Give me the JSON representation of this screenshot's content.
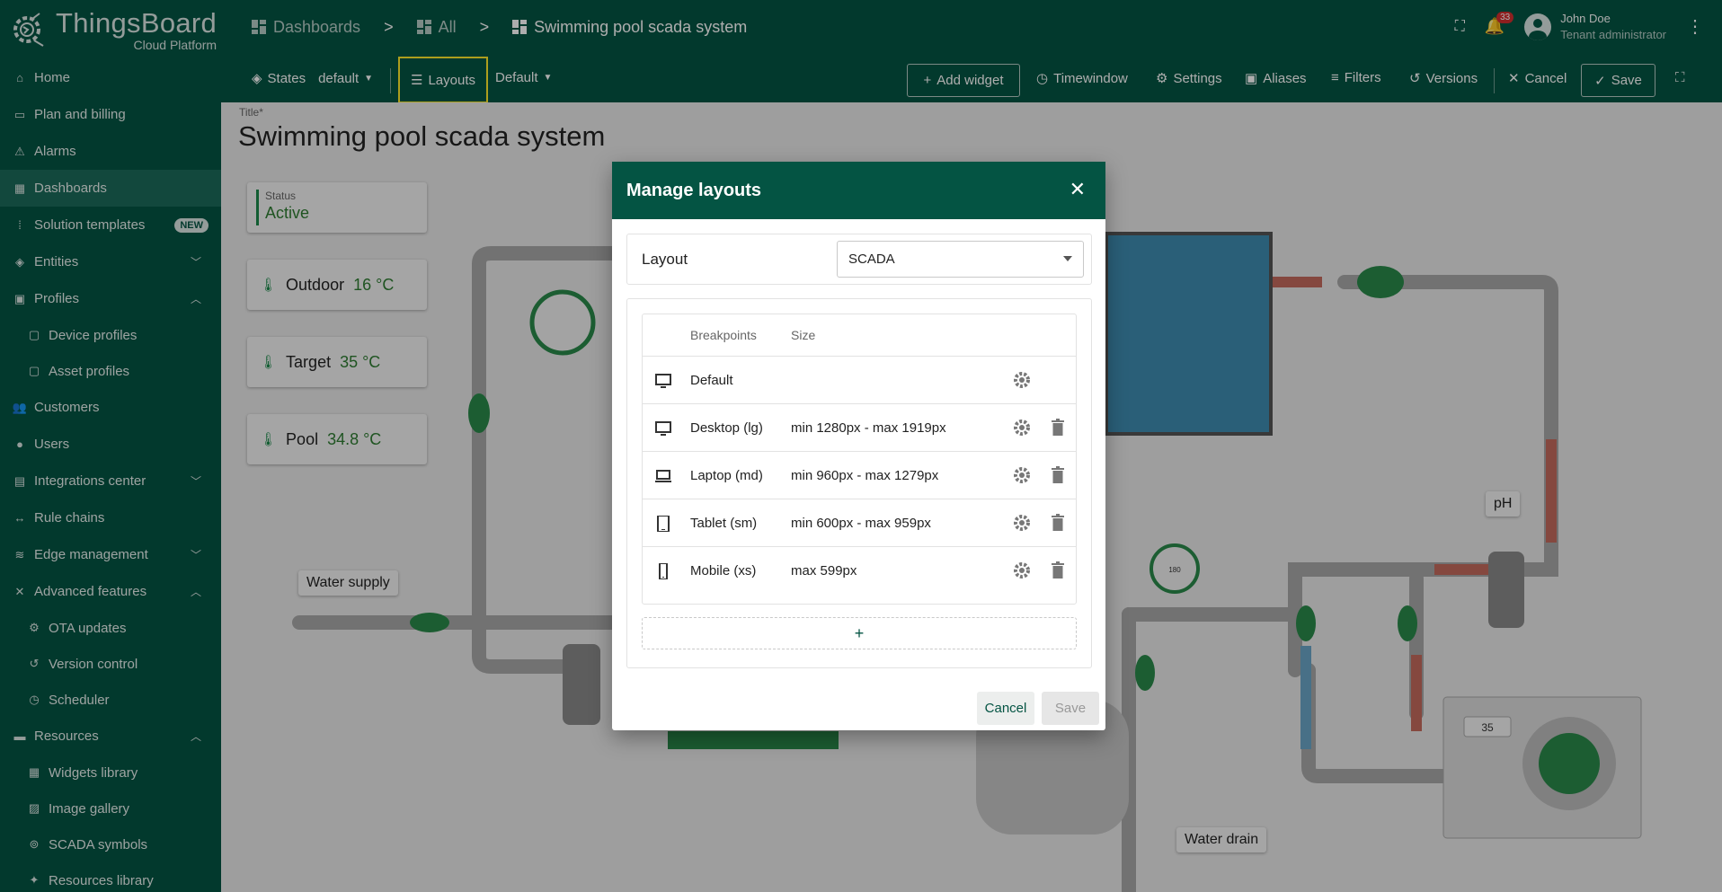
{
  "app": {
    "brand": "ThingsBoard",
    "platform": "Cloud Platform"
  },
  "sidebar": {
    "items": [
      {
        "label": "Home"
      },
      {
        "label": "Plan and billing"
      },
      {
        "label": "Alarms"
      },
      {
        "label": "Dashboards"
      },
      {
        "label": "Solution templates",
        "badge": "NEW"
      },
      {
        "label": "Entities"
      },
      {
        "label": "Profiles"
      },
      {
        "label": "Device profiles"
      },
      {
        "label": "Asset profiles"
      },
      {
        "label": "Customers"
      },
      {
        "label": "Users"
      },
      {
        "label": "Integrations center"
      },
      {
        "label": "Rule chains"
      },
      {
        "label": "Edge management"
      },
      {
        "label": "Advanced features"
      },
      {
        "label": "OTA updates"
      },
      {
        "label": "Version control"
      },
      {
        "label": "Scheduler"
      },
      {
        "label": "Resources"
      },
      {
        "label": "Widgets library"
      },
      {
        "label": "Image gallery"
      },
      {
        "label": "SCADA symbols"
      },
      {
        "label": "Resources library"
      }
    ]
  },
  "header": {
    "crumbs": [
      "Dashboards",
      "All",
      "Swimming pool scada system"
    ],
    "crumb_sep": ">",
    "notifications": "33",
    "user_name": "John Doe",
    "user_role": "Tenant administrator"
  },
  "toolbar": {
    "states_label": "States",
    "state_value": "default",
    "layouts_label": "Layouts",
    "layout_value": "Default",
    "add_widget": "Add widget",
    "timewindow": "Timewindow",
    "settings": "Settings",
    "aliases": "Aliases",
    "filters": "Filters",
    "versions": "Versions",
    "cancel": "Cancel",
    "save": "Save"
  },
  "dashboard": {
    "title_label": "Title*",
    "title": "Swimming pool scada system",
    "status": {
      "label": "Status",
      "value": "Active"
    },
    "temps": [
      {
        "label": "Outdoor",
        "value": "16 °C"
      },
      {
        "label": "Target",
        "value": "35 °C"
      },
      {
        "label": "Pool",
        "value": "34.8 °C"
      }
    ],
    "tags": {
      "water_supply": "Water supply",
      "ph": "pH",
      "water_drain": "Water drain",
      "heater_value": "35",
      "flow_value": "180"
    }
  },
  "dialog": {
    "title": "Manage layouts",
    "layout_label": "Layout",
    "layout_value": "SCADA",
    "col_breakpoints": "Breakpoints",
    "col_size": "Size",
    "breakpoints": [
      {
        "name": "Default",
        "size": ""
      },
      {
        "name": "Desktop (lg)",
        "size": "min 1280px - max 1919px"
      },
      {
        "name": "Laptop (md)",
        "size": "min 960px - max 1279px"
      },
      {
        "name": "Tablet (sm)",
        "size": "min 600px - max 959px"
      },
      {
        "name": "Mobile (xs)",
        "size": "max 599px"
      }
    ],
    "add_label": "+",
    "cancel": "Cancel",
    "save": "Save"
  },
  "colors": {
    "primary": "#045443",
    "accent_highlight": "#ffe92b",
    "status_green": "#2e7d32"
  }
}
